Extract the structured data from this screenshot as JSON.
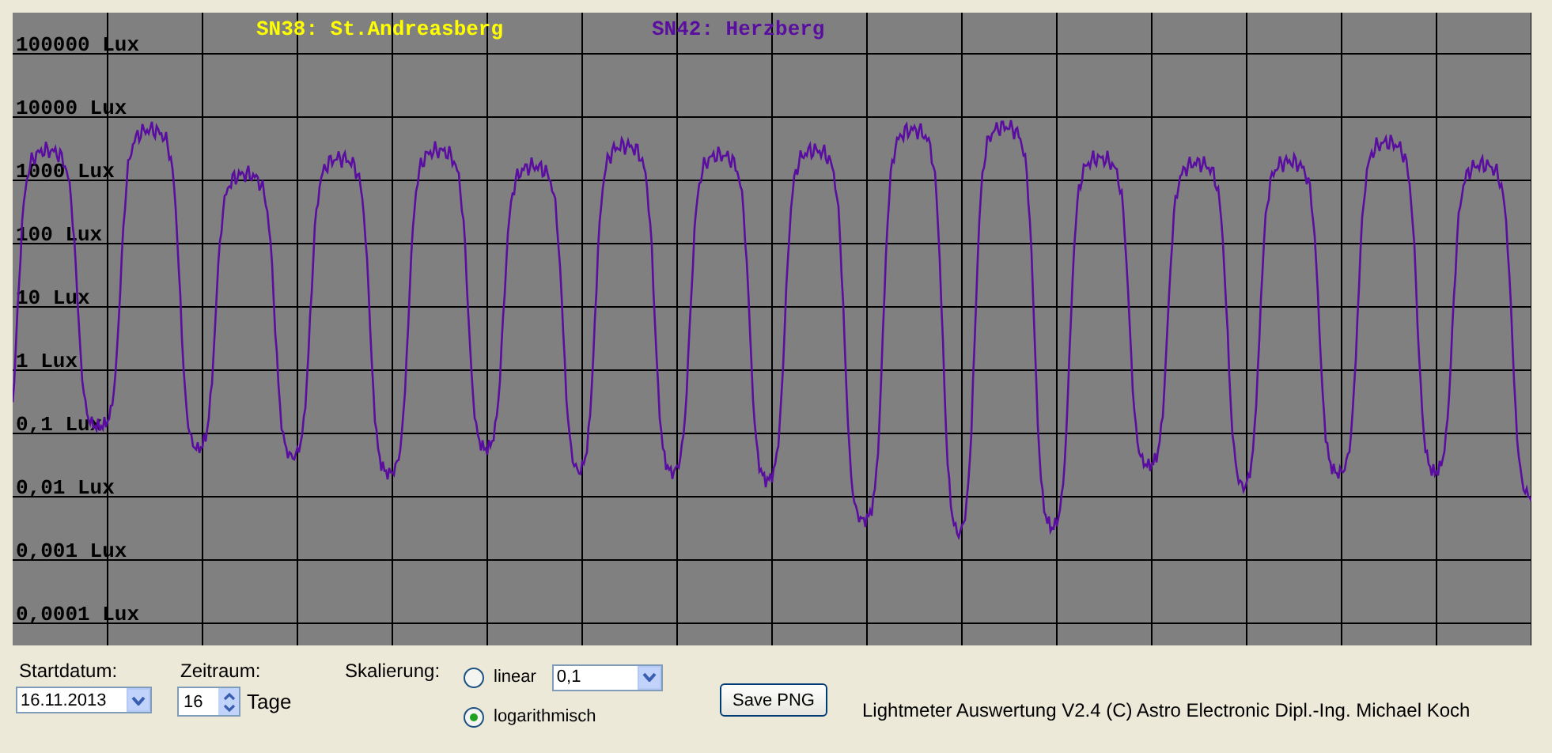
{
  "chart": {
    "legend": [
      {
        "label": "SN38: St.Andreasberg",
        "color": "#ffff00"
      },
      {
        "label": "SN42: Herzberg",
        "color": "#5a0ea0"
      }
    ],
    "y_labels": [
      "100000 Lux",
      "10000 Lux",
      "1000 Lux",
      "100 Lux",
      "10 Lux",
      "1 Lux",
      "0,1 Lux",
      "0,01 Lux",
      "0,001 Lux",
      "0,0001 Lux"
    ]
  },
  "controls": {
    "start_date": {
      "label": "Startdatum:",
      "value": "16.11.2013"
    },
    "period": {
      "label": "Zeitraum:",
      "value": "16",
      "unit": "Tage"
    },
    "scaling": {
      "label": "Skalierung:",
      "options": [
        {
          "label": "linear",
          "selected": false
        },
        {
          "label": "logarithmisch",
          "selected": true
        }
      ],
      "linear_value": "0,1"
    },
    "save_button": "Save PNG",
    "footer": "Lightmeter Auswertung V2.4  (C) Astro Electronic Dipl.-Ing. Michael Koch"
  }
}
